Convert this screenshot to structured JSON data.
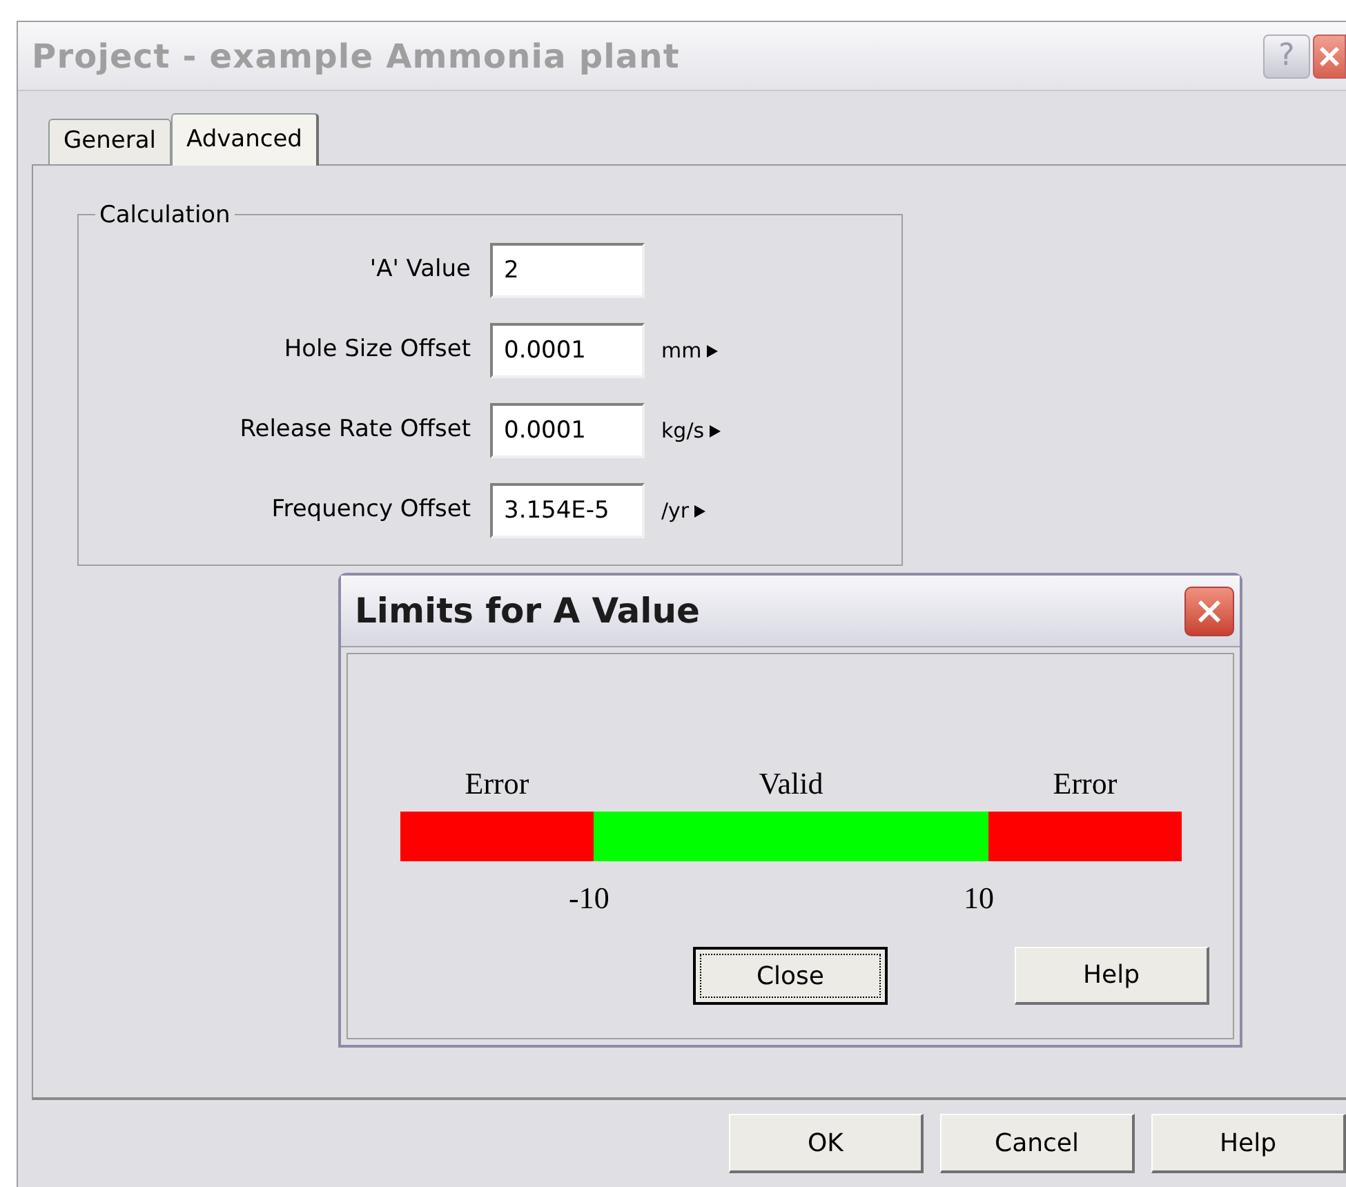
{
  "window": {
    "title": "Project - example Ammonia plant",
    "help_glyph": "?"
  },
  "tabs": [
    {
      "label": "General",
      "selected": false
    },
    {
      "label": "Advanced",
      "selected": true
    }
  ],
  "calculation": {
    "legend": "Calculation",
    "fields": [
      {
        "label": "'A' Value",
        "value": "2"
      },
      {
        "label": "Hole Size Offset",
        "value": "0.0001",
        "unit": "mm"
      },
      {
        "label": "Release Rate Offset",
        "value": "0.0001",
        "unit": "kg/s"
      },
      {
        "label": "Frequency Offset",
        "value": "3.154E-5",
        "unit": "/yr"
      }
    ]
  },
  "limits_dialog": {
    "title": "Limits for A Value",
    "segments": [
      {
        "label": "Error",
        "color": "#ff0000"
      },
      {
        "label": "Valid",
        "color": "#00ff00"
      },
      {
        "label": "Error",
        "color": "#ff0000"
      }
    ],
    "ticks": [
      "-10",
      "10"
    ],
    "buttons": [
      {
        "label": "Close",
        "focused": true
      },
      {
        "label": "Help",
        "focused": false
      }
    ]
  },
  "buttons": [
    "OK",
    "Cancel",
    "Help"
  ]
}
